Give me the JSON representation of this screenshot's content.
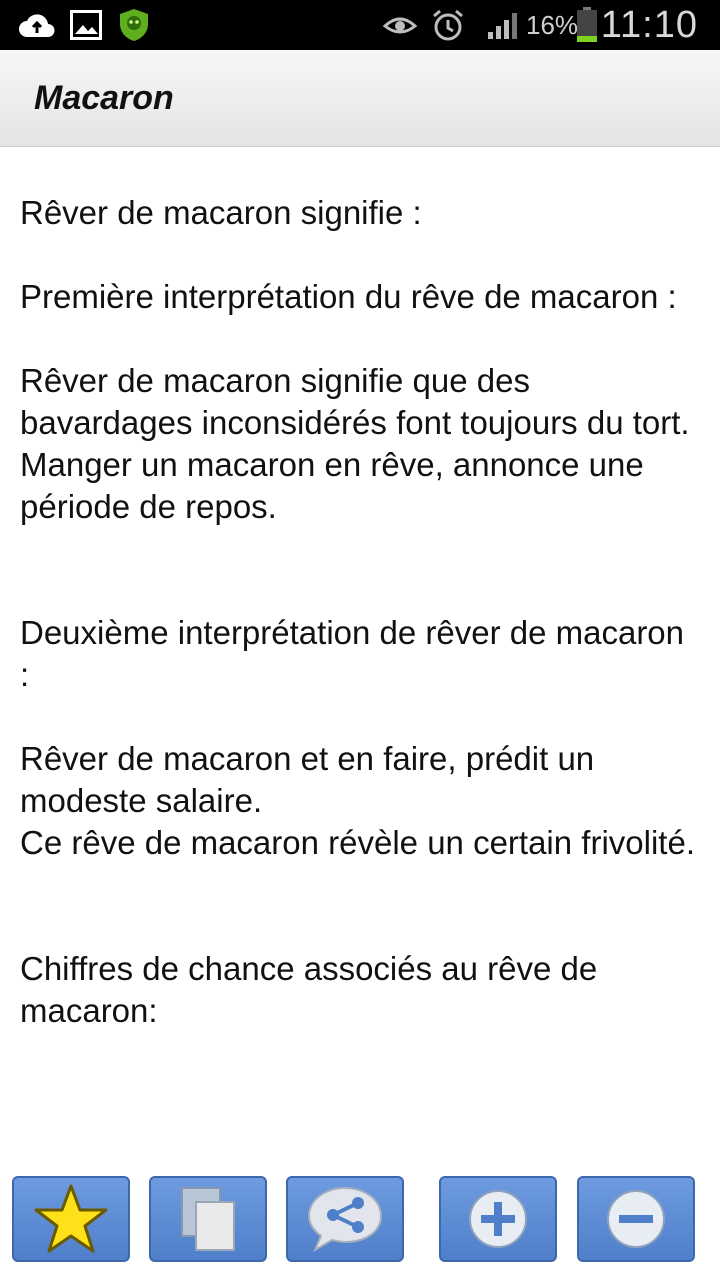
{
  "status_bar": {
    "battery_percent": "16%",
    "time": "11:10",
    "icons": [
      "cloud-upload-icon",
      "image-icon",
      "shield-icon",
      "eye-icon",
      "alarm-icon",
      "signal-icon",
      "battery-icon"
    ]
  },
  "app": {
    "title": "Macaron"
  },
  "content": {
    "heading": "Rêver de macaron signifie :",
    "first_title": "Première interprétation du rêve de macaron :",
    "first_body_1": "Rêver de macaron signifie que des bavardages inconsidérés font toujours du tort.",
    "first_body_2": "Manger un macaron en rêve, annonce une période de repos.",
    "second_title": "Deuxième interprétation de rêver de macaron :",
    "second_body_1": "Rêver de macaron et en faire, prédit un modeste salaire.",
    "second_body_2": "Ce rêve de macaron révèle un certain frivolité.",
    "lucky_title": "Chiffres de chance associés au rêve de macaron:"
  },
  "toolbar": {
    "buttons": [
      {
        "icon": "star-icon"
      },
      {
        "icon": "copy-icon"
      },
      {
        "icon": "share-icon"
      },
      {
        "icon": "zoom-in-icon"
      },
      {
        "icon": "zoom-out-icon"
      }
    ],
    "accent": "#5b8ad6",
    "star_color": "#ffe11a"
  }
}
